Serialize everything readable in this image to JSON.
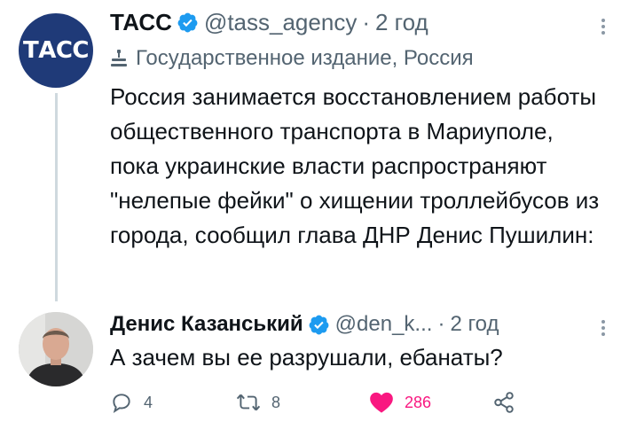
{
  "tweet": {
    "author_name": "ТАСС",
    "handle": "@tass_agency",
    "time": "2 год",
    "label": "Государственное издание, Россия",
    "text": "Россия занимается восстановлением работы общественного транспорта в Мариуполе, пока украинские власти распространяют \"нелепые фейки\" о хищении троллейбусов из города, сообщил глава ДНР Денис Пушилин:",
    "avatar_text": "ТАСС",
    "avatar_color": "#1f3a78"
  },
  "reply": {
    "author_name": "Денис Казанський",
    "handle": "@den_k...",
    "time": "2 год",
    "text": "А зачем вы ее разрушали, ебанаты?"
  },
  "actions": {
    "reply_count": "4",
    "retweet_count": "8",
    "like_count": "286"
  },
  "separator": "·",
  "colors": {
    "verified": "#1d9bf0",
    "like": "#f91880",
    "muted": "#536471"
  }
}
